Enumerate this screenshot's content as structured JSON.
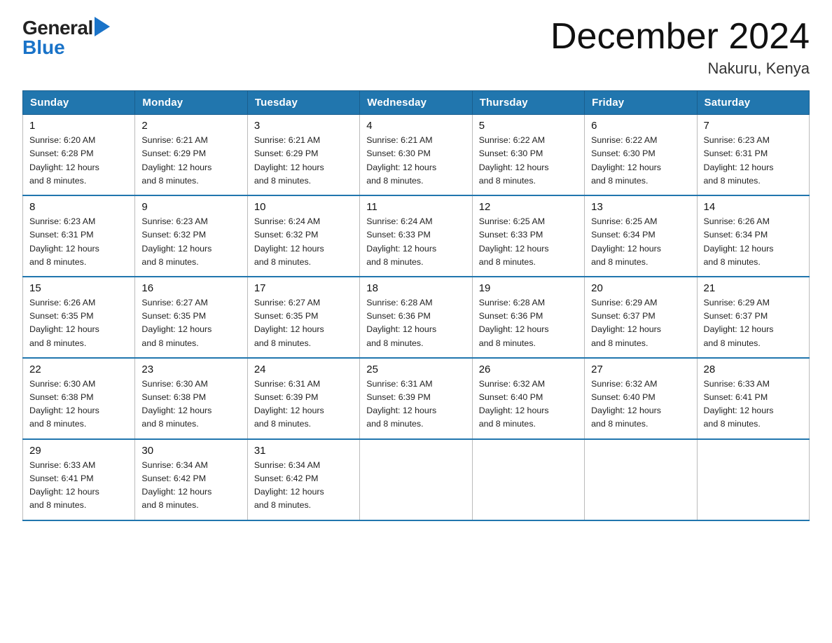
{
  "header": {
    "logo_general": "General",
    "logo_blue": "Blue",
    "title": "December 2024",
    "subtitle": "Nakuru, Kenya"
  },
  "columns": [
    "Sunday",
    "Monday",
    "Tuesday",
    "Wednesday",
    "Thursday",
    "Friday",
    "Saturday"
  ],
  "weeks": [
    [
      {
        "day": "1",
        "sunrise": "6:20 AM",
        "sunset": "6:28 PM",
        "daylight": "12 hours and 8 minutes."
      },
      {
        "day": "2",
        "sunrise": "6:21 AM",
        "sunset": "6:29 PM",
        "daylight": "12 hours and 8 minutes."
      },
      {
        "day": "3",
        "sunrise": "6:21 AM",
        "sunset": "6:29 PM",
        "daylight": "12 hours and 8 minutes."
      },
      {
        "day": "4",
        "sunrise": "6:21 AM",
        "sunset": "6:30 PM",
        "daylight": "12 hours and 8 minutes."
      },
      {
        "day": "5",
        "sunrise": "6:22 AM",
        "sunset": "6:30 PM",
        "daylight": "12 hours and 8 minutes."
      },
      {
        "day": "6",
        "sunrise": "6:22 AM",
        "sunset": "6:30 PM",
        "daylight": "12 hours and 8 minutes."
      },
      {
        "day": "7",
        "sunrise": "6:23 AM",
        "sunset": "6:31 PM",
        "daylight": "12 hours and 8 minutes."
      }
    ],
    [
      {
        "day": "8",
        "sunrise": "6:23 AM",
        "sunset": "6:31 PM",
        "daylight": "12 hours and 8 minutes."
      },
      {
        "day": "9",
        "sunrise": "6:23 AM",
        "sunset": "6:32 PM",
        "daylight": "12 hours and 8 minutes."
      },
      {
        "day": "10",
        "sunrise": "6:24 AM",
        "sunset": "6:32 PM",
        "daylight": "12 hours and 8 minutes."
      },
      {
        "day": "11",
        "sunrise": "6:24 AM",
        "sunset": "6:33 PM",
        "daylight": "12 hours and 8 minutes."
      },
      {
        "day": "12",
        "sunrise": "6:25 AM",
        "sunset": "6:33 PM",
        "daylight": "12 hours and 8 minutes."
      },
      {
        "day": "13",
        "sunrise": "6:25 AM",
        "sunset": "6:34 PM",
        "daylight": "12 hours and 8 minutes."
      },
      {
        "day": "14",
        "sunrise": "6:26 AM",
        "sunset": "6:34 PM",
        "daylight": "12 hours and 8 minutes."
      }
    ],
    [
      {
        "day": "15",
        "sunrise": "6:26 AM",
        "sunset": "6:35 PM",
        "daylight": "12 hours and 8 minutes."
      },
      {
        "day": "16",
        "sunrise": "6:27 AM",
        "sunset": "6:35 PM",
        "daylight": "12 hours and 8 minutes."
      },
      {
        "day": "17",
        "sunrise": "6:27 AM",
        "sunset": "6:35 PM",
        "daylight": "12 hours and 8 minutes."
      },
      {
        "day": "18",
        "sunrise": "6:28 AM",
        "sunset": "6:36 PM",
        "daylight": "12 hours and 8 minutes."
      },
      {
        "day": "19",
        "sunrise": "6:28 AM",
        "sunset": "6:36 PM",
        "daylight": "12 hours and 8 minutes."
      },
      {
        "day": "20",
        "sunrise": "6:29 AM",
        "sunset": "6:37 PM",
        "daylight": "12 hours and 8 minutes."
      },
      {
        "day": "21",
        "sunrise": "6:29 AM",
        "sunset": "6:37 PM",
        "daylight": "12 hours and 8 minutes."
      }
    ],
    [
      {
        "day": "22",
        "sunrise": "6:30 AM",
        "sunset": "6:38 PM",
        "daylight": "12 hours and 8 minutes."
      },
      {
        "day": "23",
        "sunrise": "6:30 AM",
        "sunset": "6:38 PM",
        "daylight": "12 hours and 8 minutes."
      },
      {
        "day": "24",
        "sunrise": "6:31 AM",
        "sunset": "6:39 PM",
        "daylight": "12 hours and 8 minutes."
      },
      {
        "day": "25",
        "sunrise": "6:31 AM",
        "sunset": "6:39 PM",
        "daylight": "12 hours and 8 minutes."
      },
      {
        "day": "26",
        "sunrise": "6:32 AM",
        "sunset": "6:40 PM",
        "daylight": "12 hours and 8 minutes."
      },
      {
        "day": "27",
        "sunrise": "6:32 AM",
        "sunset": "6:40 PM",
        "daylight": "12 hours and 8 minutes."
      },
      {
        "day": "28",
        "sunrise": "6:33 AM",
        "sunset": "6:41 PM",
        "daylight": "12 hours and 8 minutes."
      }
    ],
    [
      {
        "day": "29",
        "sunrise": "6:33 AM",
        "sunset": "6:41 PM",
        "daylight": "12 hours and 8 minutes."
      },
      {
        "day": "30",
        "sunrise": "6:34 AM",
        "sunset": "6:42 PM",
        "daylight": "12 hours and 8 minutes."
      },
      {
        "day": "31",
        "sunrise": "6:34 AM",
        "sunset": "6:42 PM",
        "daylight": "12 hours and 8 minutes."
      },
      null,
      null,
      null,
      null
    ]
  ],
  "labels": {
    "sunrise": "Sunrise:",
    "sunset": "Sunset:",
    "daylight": "Daylight:"
  }
}
